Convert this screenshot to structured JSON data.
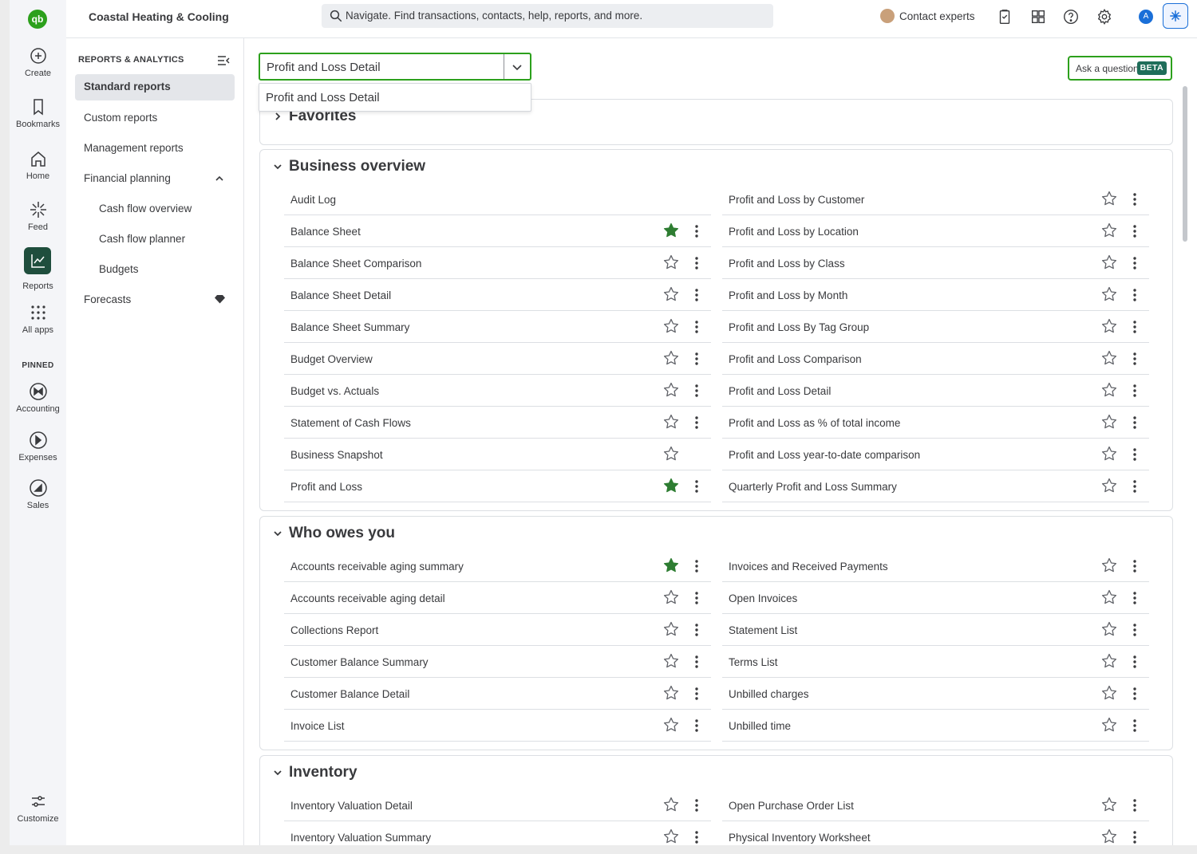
{
  "topbar": {
    "company": "Coastal Heating & Cooling",
    "search_placeholder": "Navigate. Find transactions, contacts, help, reports, and more.",
    "contact_experts": "Contact experts",
    "account_initial": "A"
  },
  "rail": {
    "logo": "qb",
    "create": "Create",
    "bookmarks": "Bookmarks",
    "home": "Home",
    "feed": "Feed",
    "reports": "Reports",
    "all_apps": "All apps",
    "pinned": "PINNED",
    "accounting": "Accounting",
    "expenses": "Expenses",
    "sales": "Sales",
    "customize": "Customize"
  },
  "sidenav": {
    "title": "REPORTS & ANALYTICS",
    "standard_reports": "Standard reports",
    "custom_reports": "Custom reports",
    "management_reports": "Management reports",
    "financial_planning": "Financial planning",
    "cash_flow_overview": "Cash flow overview",
    "cash_flow_planner": "Cash flow planner",
    "budgets": "Budgets",
    "forecasts": "Forecasts"
  },
  "main": {
    "selected_report": "Profit and Loss Detail",
    "dropdown_option": "Profit and Loss Detail",
    "ask_question": "Ask a question",
    "beta": "BETA",
    "sections": [
      {
        "title": "Favorites",
        "expanded": false,
        "left": [],
        "right": []
      },
      {
        "title": "Business overview",
        "expanded": true,
        "left": [
          {
            "name": "Audit Log",
            "favorite": false,
            "star": false,
            "menu": false
          },
          {
            "name": "Balance Sheet",
            "favorite": true,
            "star": true,
            "menu": true
          },
          {
            "name": "Balance Sheet Comparison",
            "favorite": false,
            "star": true,
            "menu": true
          },
          {
            "name": "Balance Sheet Detail",
            "favorite": false,
            "star": true,
            "menu": true
          },
          {
            "name": "Balance Sheet Summary",
            "favorite": false,
            "star": true,
            "menu": true
          },
          {
            "name": "Budget Overview",
            "favorite": false,
            "star": true,
            "menu": true
          },
          {
            "name": "Budget vs. Actuals",
            "favorite": false,
            "star": true,
            "menu": true
          },
          {
            "name": "Statement of Cash Flows",
            "favorite": false,
            "star": true,
            "menu": true
          },
          {
            "name": "Business Snapshot",
            "favorite": false,
            "star": true,
            "menu": false
          },
          {
            "name": "Profit and Loss",
            "favorite": true,
            "star": true,
            "menu": true
          }
        ],
        "right": [
          {
            "name": "Profit and Loss by Customer",
            "favorite": false,
            "star": true,
            "menu": true
          },
          {
            "name": "Profit and Loss by Location",
            "favorite": false,
            "star": true,
            "menu": true
          },
          {
            "name": "Profit and Loss by Class",
            "favorite": false,
            "star": true,
            "menu": true
          },
          {
            "name": "Profit and Loss by Month",
            "favorite": false,
            "star": true,
            "menu": true
          },
          {
            "name": "Profit and Loss By Tag Group",
            "favorite": false,
            "star": true,
            "menu": true
          },
          {
            "name": "Profit and Loss Comparison",
            "favorite": false,
            "star": true,
            "menu": true
          },
          {
            "name": "Profit and Loss Detail",
            "favorite": false,
            "star": true,
            "menu": true
          },
          {
            "name": "Profit and Loss as % of total income",
            "favorite": false,
            "star": true,
            "menu": true
          },
          {
            "name": "Profit and Loss year-to-date comparison",
            "favorite": false,
            "star": true,
            "menu": true
          },
          {
            "name": "Quarterly Profit and Loss Summary",
            "favorite": false,
            "star": true,
            "menu": true
          }
        ]
      },
      {
        "title": "Who owes you",
        "expanded": true,
        "left": [
          {
            "name": "Accounts receivable aging summary",
            "favorite": true,
            "star": true,
            "menu": true
          },
          {
            "name": "Accounts receivable aging detail",
            "favorite": false,
            "star": true,
            "menu": true
          },
          {
            "name": "Collections Report",
            "favorite": false,
            "star": true,
            "menu": true
          },
          {
            "name": "Customer Balance Summary",
            "favorite": false,
            "star": true,
            "menu": true
          },
          {
            "name": "Customer Balance Detail",
            "favorite": false,
            "star": true,
            "menu": true
          },
          {
            "name": "Invoice List",
            "favorite": false,
            "star": true,
            "menu": true
          }
        ],
        "right": [
          {
            "name": "Invoices and Received Payments",
            "favorite": false,
            "star": true,
            "menu": true
          },
          {
            "name": "Open Invoices",
            "favorite": false,
            "star": true,
            "menu": true
          },
          {
            "name": "Statement List",
            "favorite": false,
            "star": true,
            "menu": true
          },
          {
            "name": "Terms List",
            "favorite": false,
            "star": true,
            "menu": true
          },
          {
            "name": "Unbilled charges",
            "favorite": false,
            "star": true,
            "menu": true
          },
          {
            "name": "Unbilled time",
            "favorite": false,
            "star": true,
            "menu": true
          }
        ]
      },
      {
        "title": "Inventory",
        "expanded": true,
        "left": [
          {
            "name": "Inventory Valuation Detail",
            "favorite": false,
            "star": true,
            "menu": true
          },
          {
            "name": "Inventory Valuation Summary",
            "favorite": false,
            "star": true,
            "menu": true
          }
        ],
        "right": [
          {
            "name": "Open Purchase Order List",
            "favorite": false,
            "star": true,
            "menu": true
          },
          {
            "name": "Physical Inventory Worksheet",
            "favorite": false,
            "star": true,
            "menu": true
          }
        ]
      }
    ]
  },
  "colors": {
    "brand_green": "#2ca01c",
    "favorite_star": "#2e7d32",
    "active_nav": "#e4e6ea",
    "reports_active_bg": "#1f4e3d",
    "beta_badge": "#1f6e5a",
    "account_avatar": "#1a6fd8"
  }
}
